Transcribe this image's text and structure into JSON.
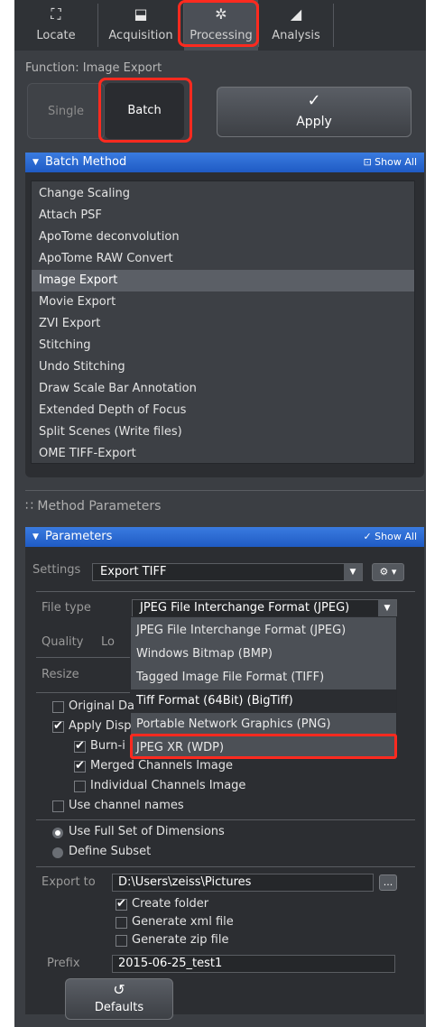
{
  "tabs": [
    {
      "label": "Locate",
      "icon": "locate-icon"
    },
    {
      "label": "Acquisition",
      "icon": "acquisition-icon"
    },
    {
      "label": "Processing",
      "icon": "processing-gear-icon"
    },
    {
      "label": "Analysis",
      "icon": "analysis-icon"
    }
  ],
  "function_label": "Function:  Image Export",
  "mode": {
    "single": "Single",
    "batch": "Batch"
  },
  "apply": {
    "check": "✓",
    "label": "Apply"
  },
  "batch_method": {
    "header": "Batch Method",
    "show_all": "⊡ Show All",
    "items": [
      "Change Scaling",
      "Attach PSF",
      "ApoTome deconvolution",
      "ApoTome RAW Convert",
      "Image Export",
      "Movie Export",
      "ZVI Export",
      "Stitching",
      "Undo Stitching",
      "Draw Scale Bar Annotation",
      "Extended Depth of Focus",
      "Split Scenes (Write files)",
      "OME TIFF-Export"
    ],
    "selected": "Image Export"
  },
  "method_parameters": "Method Parameters",
  "parameters": {
    "header": "Parameters",
    "show_all": "✓ Show All",
    "settings_label": "Settings",
    "settings_value": "Export TIFF",
    "gear_label": "⚙ ▾",
    "file_type_label": "File type",
    "file_type_value": "JPEG File Interchange Format (JPEG)",
    "quality_label": "Quality",
    "quality_partial": "Lo",
    "resize_label": "Resize",
    "file_type_options": [
      "JPEG File Interchange Format (JPEG)",
      "Windows Bitmap (BMP)",
      "Tagged Image File Format (TIFF)",
      "Tiff Format (64Bit) (BigTiff)",
      "Portable Network Graphics (PNG)",
      "JPEG XR (WDP)"
    ],
    "highlighted_option": "Tiff Format (64Bit) (BigTiff)",
    "original_data": "Original Da",
    "apply_display": "Apply Disp",
    "burn_in": "Burn-i",
    "merged_channels": "Merged Channels Image",
    "individual_channels": "Individual Channels Image",
    "use_channel_names": "Use channel names",
    "use_full_set": "Use Full Set of Dimensions",
    "define_subset": "Define Subset",
    "export_to_label": "Export to",
    "export_to_value": "D:\\Users\\zeiss\\Pictures",
    "browse_label": "...",
    "create_folder": "Create folder",
    "generate_xml": "Generate xml file",
    "generate_zip": "Generate zip file",
    "prefix_label": "Prefix",
    "prefix_value": "2015-06-25_test1",
    "defaults_icon": "↺",
    "defaults_label": "Defaults"
  },
  "colors": {
    "highlight": "#ff2a1f",
    "header_blue": "#2a6ad6",
    "panel": "#3b3e43"
  }
}
